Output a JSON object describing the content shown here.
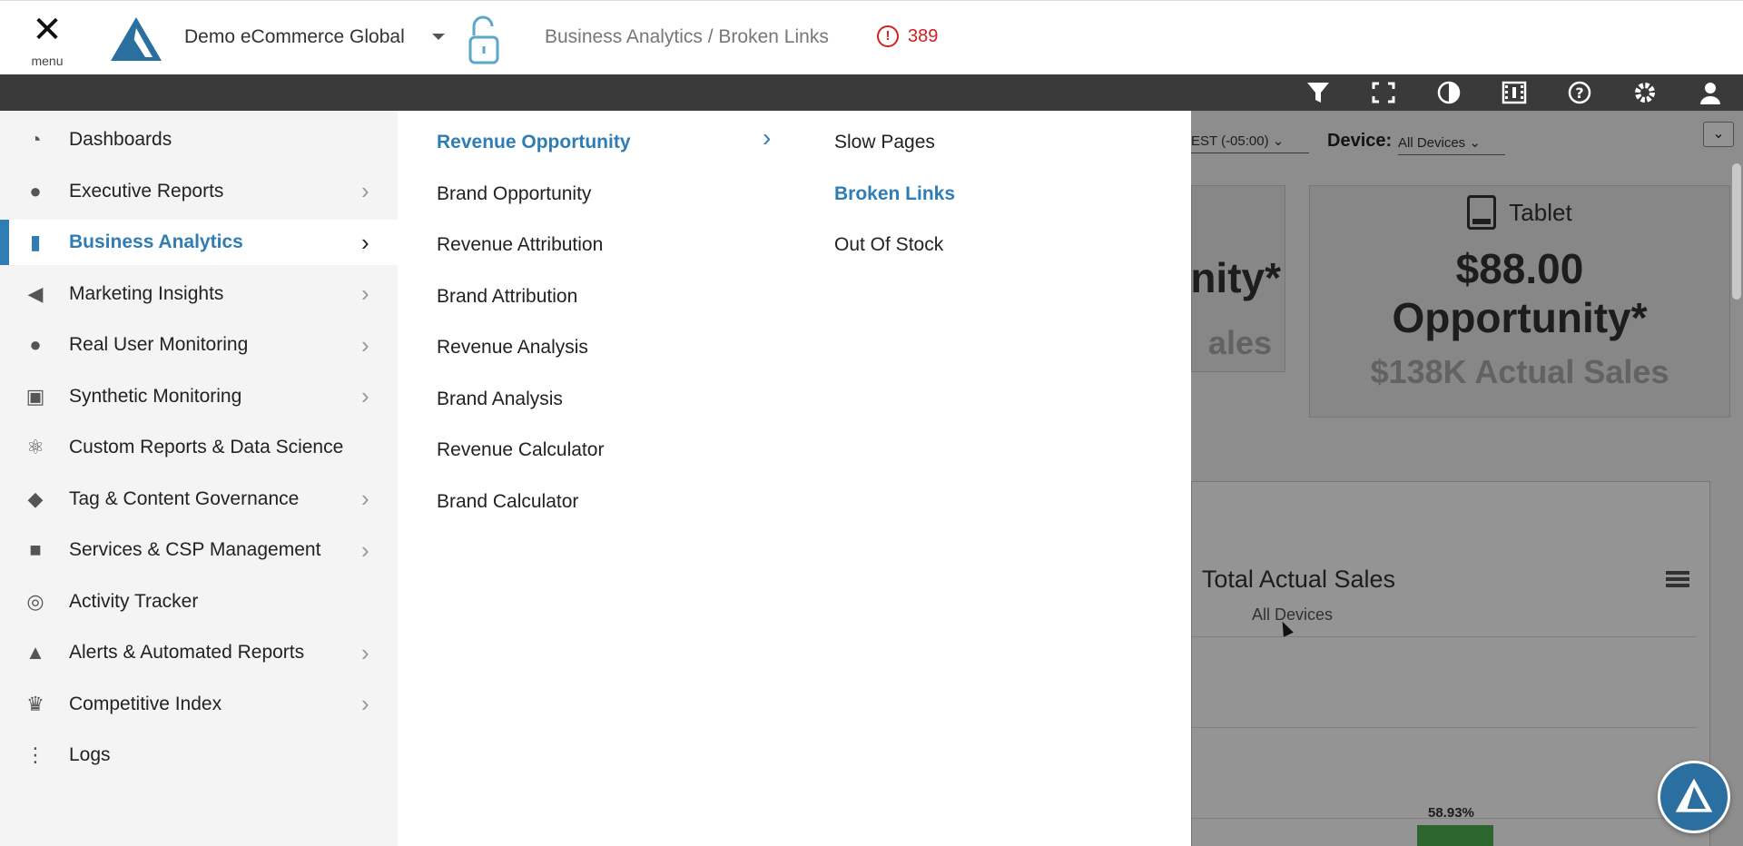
{
  "header": {
    "menu_label": "menu",
    "org_name": "Demo eCommerce Global",
    "breadcrumb": "Business Analytics / Broken Links",
    "alert_count": "389"
  },
  "toolbar": {
    "icons": [
      "filter-icon",
      "fullscreen-icon",
      "contrast-icon",
      "video-icon",
      "help-icon",
      "settings-icon",
      "user-icon"
    ]
  },
  "sidebar": {
    "items": [
      {
        "label": "Dashboards",
        "icon": "gauge-icon",
        "has_submenu": false
      },
      {
        "label": "Executive Reports",
        "icon": "executive-icon",
        "has_submenu": true
      },
      {
        "label": "Business Analytics",
        "icon": "bar-chart-icon",
        "has_submenu": true,
        "active": true
      },
      {
        "label": "Marketing Insights",
        "icon": "megaphone-icon",
        "has_submenu": true
      },
      {
        "label": "Real User Monitoring",
        "icon": "users-icon",
        "has_submenu": true
      },
      {
        "label": "Synthetic Monitoring",
        "icon": "robot-icon",
        "has_submenu": true
      },
      {
        "label": "Custom Reports & Data Science",
        "icon": "atom-icon",
        "has_submenu": false
      },
      {
        "label": "Tag & Content Governance",
        "icon": "tag-icon",
        "has_submenu": true
      },
      {
        "label": "Services & CSP Management",
        "icon": "lock-icon",
        "has_submenu": true
      },
      {
        "label": "Activity Tracker",
        "icon": "fingerprint-icon",
        "has_submenu": false
      },
      {
        "label": "Alerts & Automated Reports",
        "icon": "bell-icon",
        "has_submenu": true
      },
      {
        "label": "Competitive Index",
        "icon": "trophy-icon",
        "has_submenu": true
      },
      {
        "label": "Logs",
        "icon": "tree-icon",
        "has_submenu": false
      }
    ]
  },
  "submenu": {
    "column1": [
      "Revenue Opportunity",
      "Brand Opportunity",
      "Revenue Attribution",
      "Brand Attribution",
      "Revenue Analysis",
      "Brand Analysis",
      "Revenue Calculator",
      "Brand Calculator"
    ],
    "column2": [
      "Slow Pages",
      "Broken Links",
      "Out Of Stock"
    ]
  },
  "dashboard": {
    "timezone_value": "EST (-05:00)",
    "device_label": "Device:",
    "device_value": "All Devices",
    "card_left_big": "nity*",
    "card_left_sub": "ales",
    "tablet_title": "Tablet",
    "tablet_amount_line1": "$88.00",
    "tablet_amount_line2": "Opportunity*",
    "tablet_sales": "$138K Actual Sales",
    "chart_title": "Total Actual Sales",
    "chart_subtitle": "All Devices",
    "bar_percent": "58.93%"
  },
  "colors": {
    "accent": "#2f7db3",
    "alert": "#d32020",
    "toolbar": "#3a3a3a"
  }
}
